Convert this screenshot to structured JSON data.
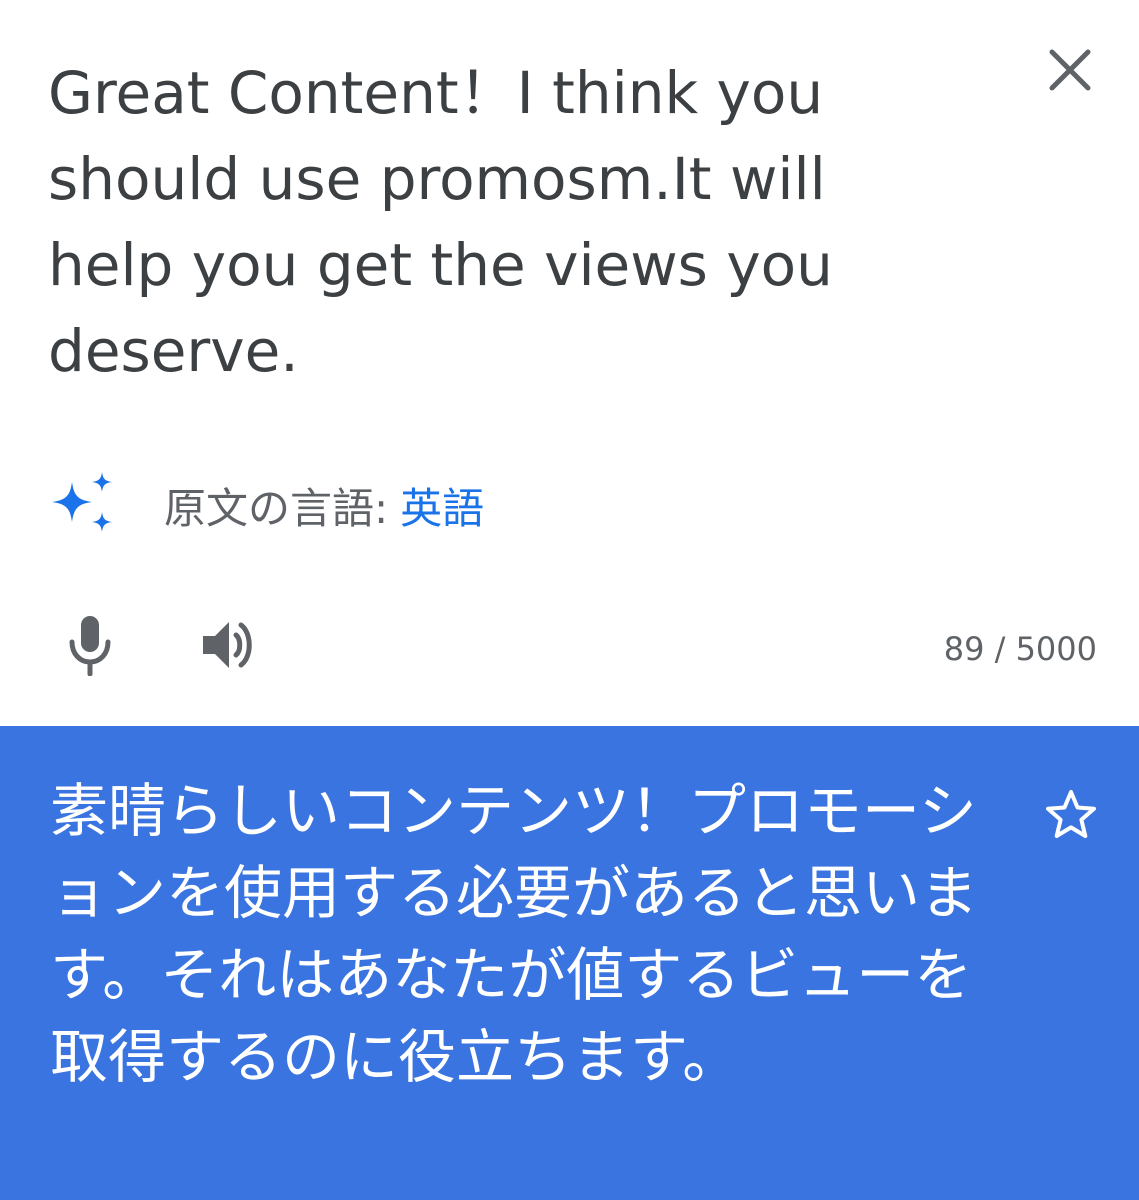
{
  "source": {
    "text": "Great Content！I think you should use promosm.It will help you get the views you deserve.",
    "detected_label": "原文の言語:",
    "detected_language": "英語",
    "char_count": "89 / 5000"
  },
  "result": {
    "text": "素晴らしいコンテンツ！プロモーションを使用する必要があると思います。それはあなたが値するビューを取得するのに役立ちます。"
  },
  "icons": {
    "close": "close-icon",
    "sparkle": "sparkle-icon",
    "mic": "mic-icon",
    "speaker": "speaker-icon",
    "star": "star-icon"
  },
  "colors": {
    "accent": "#1a73e8",
    "result_bg": "#3a74e0",
    "source_text": "#3c4043",
    "secondary_text": "#5f6368"
  }
}
